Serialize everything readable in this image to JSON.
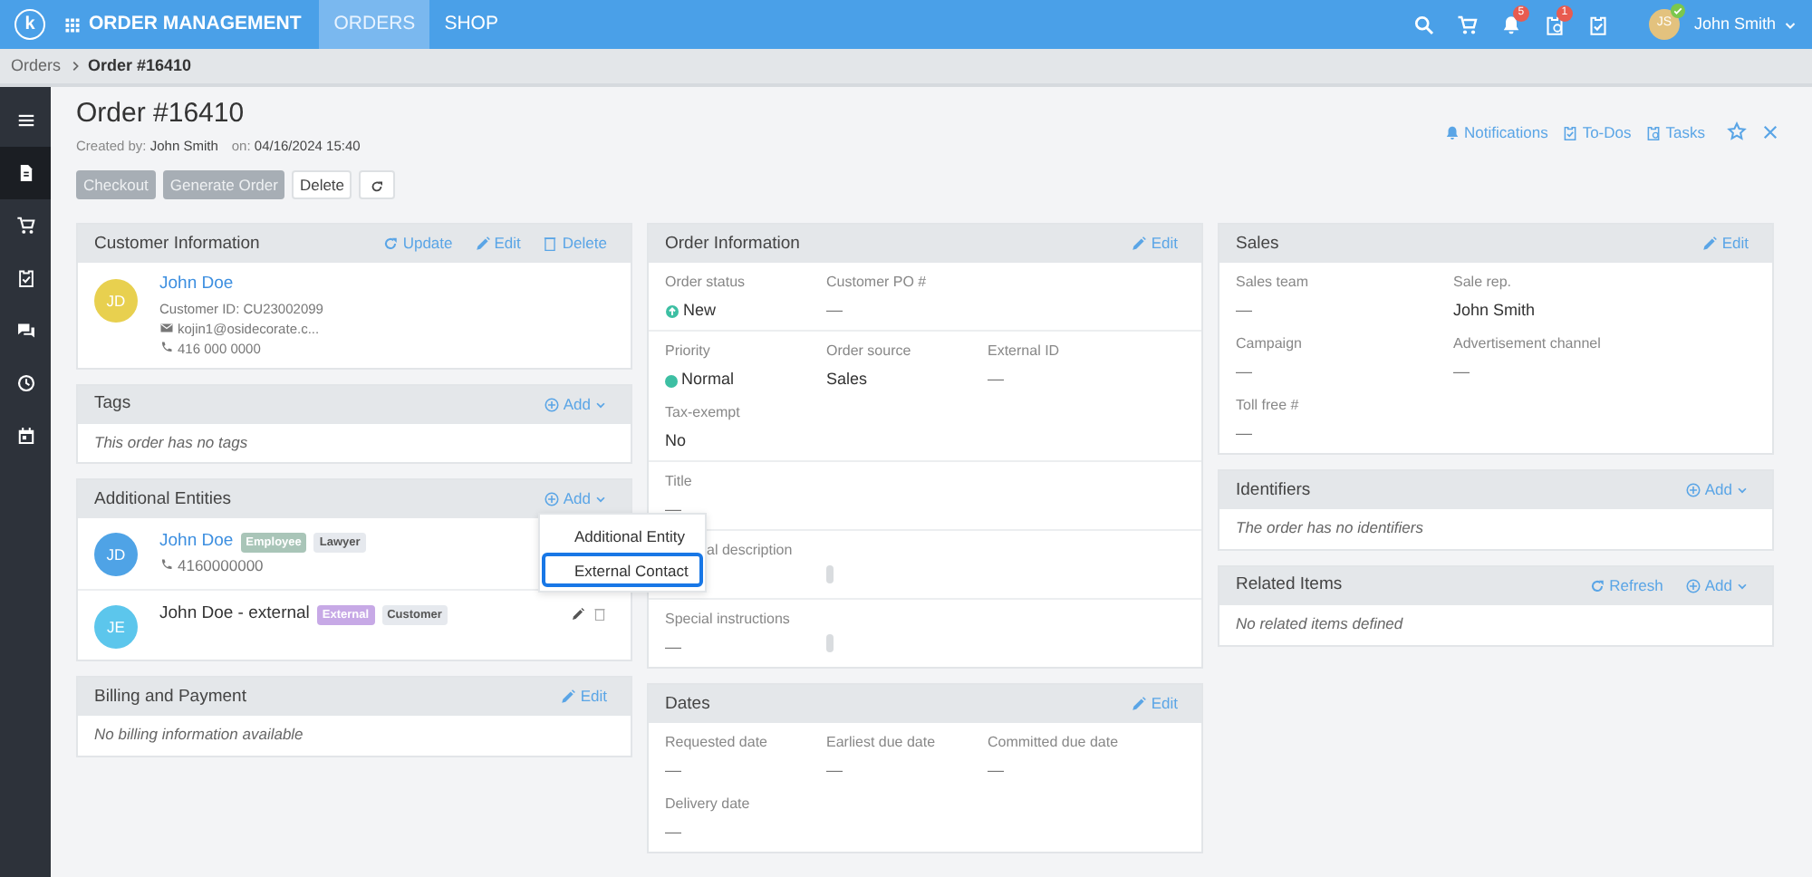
{
  "app": {
    "logo": "k",
    "title": "ORDER MANAGEMENT",
    "tabs": [
      {
        "label": "ORDERS",
        "selected": true
      },
      {
        "label": "SHOP",
        "selected": false
      }
    ],
    "notifications_badge": "5",
    "tasks_badge": "1",
    "user": {
      "initials": "JS",
      "name": "John Smith",
      "online": true
    }
  },
  "breadcrumb": [
    {
      "label": "Orders",
      "current": false
    },
    {
      "label": "Order #16410",
      "current": true
    }
  ],
  "sidebar": [
    {
      "selected": false
    },
    {
      "selected": true
    },
    {
      "selected": false
    },
    {
      "selected": false
    },
    {
      "selected": false
    },
    {
      "selected": false
    },
    {
      "selected": false
    }
  ],
  "page": {
    "title": "Order #16410",
    "created_by_label": "Created by:",
    "created_by": "John Smith",
    "on_label": "on:",
    "created_on": "04/16/2024 15:40",
    "links": [
      "Notifications",
      "To-Dos",
      "Tasks"
    ],
    "buttons": [
      {
        "kind": "text",
        "label": "Checkout",
        "disabled": true
      },
      {
        "kind": "text",
        "label": "Generate Order",
        "disabled": true
      },
      {
        "kind": "text",
        "label": "Delete",
        "disabled": false
      },
      {
        "kind": "refresh",
        "disabled": false
      }
    ]
  },
  "columns": [
    [
      {
        "title": "Customer Information",
        "actions": [
          {
            "kind": "refresh",
            "label": "Update"
          },
          {
            "kind": "edit",
            "label": "Edit"
          },
          {
            "kind": "delete",
            "label": "Delete"
          }
        ],
        "body": {
          "kind": "contact",
          "initials": "JD",
          "color": "#e8d04f",
          "name": "John Doe",
          "id_label": "Customer ID:",
          "id": "CU23002099",
          "email": "kojin1@osidecorate.c...",
          "phone": "416 000 0000"
        }
      },
      {
        "title": "Tags",
        "actions": [
          {
            "kind": "add",
            "label": "Add"
          }
        ],
        "body": {
          "kind": "empty",
          "text": "This order has no tags"
        }
      },
      {
        "title": "Additional Entities",
        "actions": [
          {
            "kind": "add",
            "label": "Add",
            "menu": [
              {
                "label": "Additional Entity",
                "selected": false
              },
              {
                "label": "External Contact",
                "selected": true
              }
            ]
          }
        ],
        "body": {
          "kind": "entities",
          "items": [
            {
              "initials": "JD",
              "color": "#4fa3e6",
              "name": "John Doe",
              "link": true,
              "tags": [
                {
                  "label": "Employee",
                  "color": "#a9c5b8"
                },
                {
                  "label": "Lawyer",
                  "color": "#e6e9ee"
                }
              ],
              "phone": "4160000000",
              "editable": false
            },
            {
              "initials": "JE",
              "color": "#5cc6ec",
              "name": "John Doe - external",
              "link": false,
              "tags": [
                {
                  "label": "External",
                  "color": "#c7a9e6"
                },
                {
                  "label": "Customer",
                  "color": "#e6e9ee"
                }
              ],
              "editable": true
            }
          ]
        }
      },
      {
        "title": "Billing and Payment",
        "actions": [
          {
            "kind": "edit",
            "label": "Edit"
          }
        ],
        "body": {
          "kind": "empty",
          "text": "No billing information available"
        }
      }
    ],
    [
      {
        "title": "Order Information",
        "actions": [
          {
            "kind": "edit",
            "label": "Edit"
          }
        ],
        "body": {
          "kind": "fields",
          "sections": [
            [
              [
                {
                  "label": "Order status",
                  "value": "New",
                  "kind": "status",
                  "color": "#3dbfa3"
                },
                {
                  "label": "Customer PO #",
                  "value": "—"
                }
              ]
            ],
            [
              [
                {
                  "label": "Priority",
                  "value": "Normal",
                  "kind": "dot",
                  "color": "#3dbfa3"
                },
                {
                  "label": "Order source",
                  "value": "Sales"
                },
                {
                  "label": "External ID",
                  "value": "—"
                }
              ],
              [
                {
                  "label": "Tax-exempt",
                  "value": "No"
                }
              ]
            ],
            [
              [
                {
                  "label": "Title",
                  "value": "—"
                }
              ]
            ],
            [
              [
                {
                  "label": "al description",
                  "kind": "covered"
                }
              ]
            ],
            [
              [
                {
                  "label": "Special instructions",
                  "value": "—",
                  "kind": "textarea"
                }
              ]
            ]
          ]
        }
      },
      {
        "title": "Dates",
        "actions": [
          {
            "kind": "edit",
            "label": "Edit"
          }
        ],
        "body": {
          "kind": "fields",
          "sections": [
            [
              [
                {
                  "label": "Requested date",
                  "value": "—"
                },
                {
                  "label": "Earliest due date",
                  "value": "—"
                },
                {
                  "label": "Committed due date",
                  "value": "—"
                }
              ],
              [
                {
                  "label": "Delivery date",
                  "value": "—"
                }
              ]
            ]
          ]
        }
      }
    ],
    [
      {
        "title": "Sales",
        "actions": [
          {
            "kind": "edit",
            "label": "Edit"
          }
        ],
        "body": {
          "kind": "fields",
          "sections": [
            [
              [
                {
                  "label": "Sales team",
                  "value": "—"
                },
                {
                  "label": "Sale rep.",
                  "value": "John Smith"
                }
              ],
              [
                {
                  "label": "Campaign",
                  "value": "—"
                },
                {
                  "label": "Advertisement channel",
                  "value": "—"
                }
              ],
              [
                {
                  "label": "Toll free #",
                  "value": "—"
                }
              ]
            ]
          ]
        }
      },
      {
        "title": "Identifiers",
        "actions": [
          {
            "kind": "add",
            "label": "Add"
          }
        ],
        "body": {
          "kind": "empty",
          "text": "The order has no identifiers"
        }
      },
      {
        "title": "Related Items",
        "actions": [
          {
            "kind": "refresh",
            "label": "Refresh"
          },
          {
            "kind": "add",
            "label": "Add"
          }
        ],
        "body": {
          "kind": "empty",
          "text": "No related items defined"
        }
      }
    ]
  ]
}
